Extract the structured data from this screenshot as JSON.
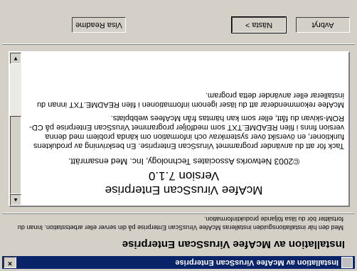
{
  "window": {
    "title": "Installation av McAfee VirusScan Enterprise",
    "close_glyph": "×"
  },
  "header": {
    "title": "Installation av McAfee VirusScan Enterprise",
    "description": "Med den här installationsguiden installeras McAfee VirusScan Enterprise på din server eller arbetsstation. Innan du fortsätter bör du läsa följande produktinformation."
  },
  "readme": {
    "product": "McAfee VirusScan Enterprise",
    "version": "Version 7.1.0",
    "copyright": "©2003 Networks Associates Technology, Inc. Med ensamrätt.",
    "paragraph1": "Tack för att du använder programmet VirusScan Enterprise. En beskrivning av produktens funktioner, en översikt över systemkrav och information om kända problem med denna version finns i filen README.TXT som medföljer programmet VirusScan Enterprise på CD-ROM-skivan du fått, eller som kan hämtas från McAfees webbplats.",
    "paragraph2": "McAfee rekommenderar att du läser igenom informationen i filen README.TXT innan du installerar eller använder detta program."
  },
  "scrollbar": {
    "up_glyph": "▲",
    "down_glyph": "▼"
  },
  "buttons": {
    "readme": "Visa Readme",
    "next": "Nästa >",
    "cancel": "Avbryt"
  }
}
